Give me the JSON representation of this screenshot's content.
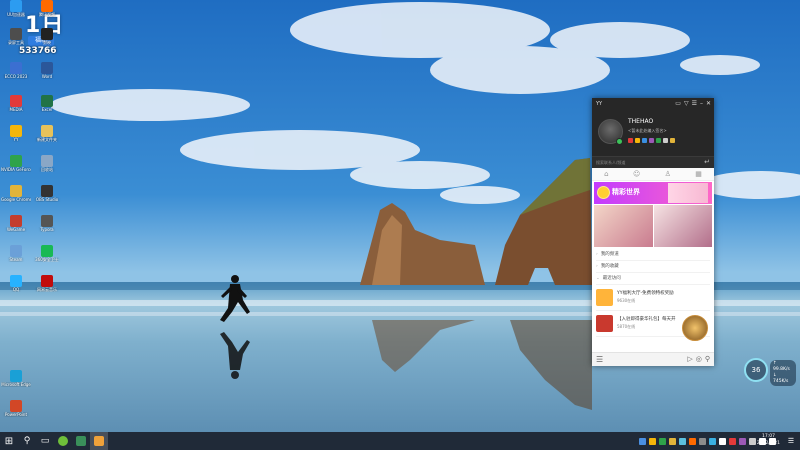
{
  "desktop": {
    "brand_mark": "1日",
    "brand_badge": "福利",
    "brand_number": "533766",
    "icons": [
      {
        "label": "ECCO 2023",
        "color": "#3b6fd1"
      },
      {
        "label": "MEDIA",
        "color": "#e23a3a"
      },
      {
        "label": "YY",
        "color": "#f5b60a"
      },
      {
        "label": "NVIDIA GeForce Exp",
        "color": "#2fa34a"
      },
      {
        "label": "Google Chrome",
        "color": "#e2b43a"
      },
      {
        "label": "WeGame",
        "color": "#c43d2d"
      },
      {
        "label": "Steam",
        "color": "#6ba0d8"
      },
      {
        "label": "QQ",
        "color": "#27b2ff"
      },
      {
        "label": "Microsoft Edge",
        "color": "#1aa0d6"
      },
      {
        "label": "PowerPoint",
        "color": "#d24726"
      },
      {
        "label": "Word",
        "color": "#2b579a"
      },
      {
        "label": "Excel",
        "color": "#217346"
      },
      {
        "label": "新建文件夹",
        "color": "#e7c25a"
      },
      {
        "label": "回收站",
        "color": "#8aa7c6"
      },
      {
        "label": "OBS Studio",
        "color": "#333333"
      },
      {
        "label": "Typora",
        "color": "#555555"
      },
      {
        "label": "360安全卫士",
        "color": "#19b955"
      },
      {
        "label": "网易云音乐",
        "color": "#c20c0c"
      },
      {
        "label": "UU加速器",
        "color": "#2c9cf1"
      },
      {
        "label": "腾讯视频",
        "color": "#ff6a00"
      },
      {
        "label": "录屏工具",
        "color": "#4d4d4d"
      },
      {
        "label": "剪映",
        "color": "#222222"
      }
    ]
  },
  "yy_window": {
    "title": "YY",
    "controls": [
      "▭",
      "▽",
      "☰",
      "–",
      "✕"
    ],
    "nickname": "THEHAO",
    "signature": "<暂未此处编入签名>",
    "search_placeholder": "搜索联系人/频道",
    "search_enter": "↵",
    "tabs": [
      "⌂",
      "☺",
      "♙",
      "▦"
    ],
    "banner_title": "精彩世界",
    "rows": [
      {
        "label": "我的频道"
      },
      {
        "label": "我的收藏"
      },
      {
        "label": "最近访问"
      }
    ],
    "items": [
      {
        "title": "YY福利大厅-免费领特权奖励",
        "sub": "9630在线",
        "color": "#ffb43a"
      },
      {
        "title": "【入驻即得豪华礼包】每天开",
        "sub": "5870在线",
        "color": "#c9392e"
      }
    ],
    "footer_menu": "☰",
    "footer_icons": [
      "▷",
      "◎",
      "⚲"
    ]
  },
  "speed_widget": {
    "percent": "36",
    "up_rate": "↑ 99.8K/s",
    "down_rate": "↓ 745K/s"
  },
  "taskbar": {
    "start_icon": "⊞",
    "apps": [
      {
        "name": "search",
        "glyph": "⚲",
        "color": "#ffffff"
      },
      {
        "name": "task-view",
        "glyph": "▭",
        "color": "#ffffff"
      },
      {
        "name": "app-1",
        "glyph": "",
        "color": "#6fbf3a"
      },
      {
        "name": "app-2",
        "glyph": "",
        "color": "#3a8f5a"
      },
      {
        "name": "app-3",
        "glyph": "",
        "color": "#f0a23a"
      }
    ],
    "tray_icons": [
      "#4a90e2",
      "#f5b60a",
      "#2fa34a",
      "#e2b43a",
      "#5bc0de",
      "#ff6a00",
      "#8c8c8c",
      "#3ab0e2",
      "#ffffff",
      "#e23a3a",
      "#9b59b6",
      "#cccccc",
      "#ffffff",
      "#ffffff"
    ],
    "time": "17:07",
    "date": "2022/6/21",
    "notification_glyph": "☰"
  }
}
